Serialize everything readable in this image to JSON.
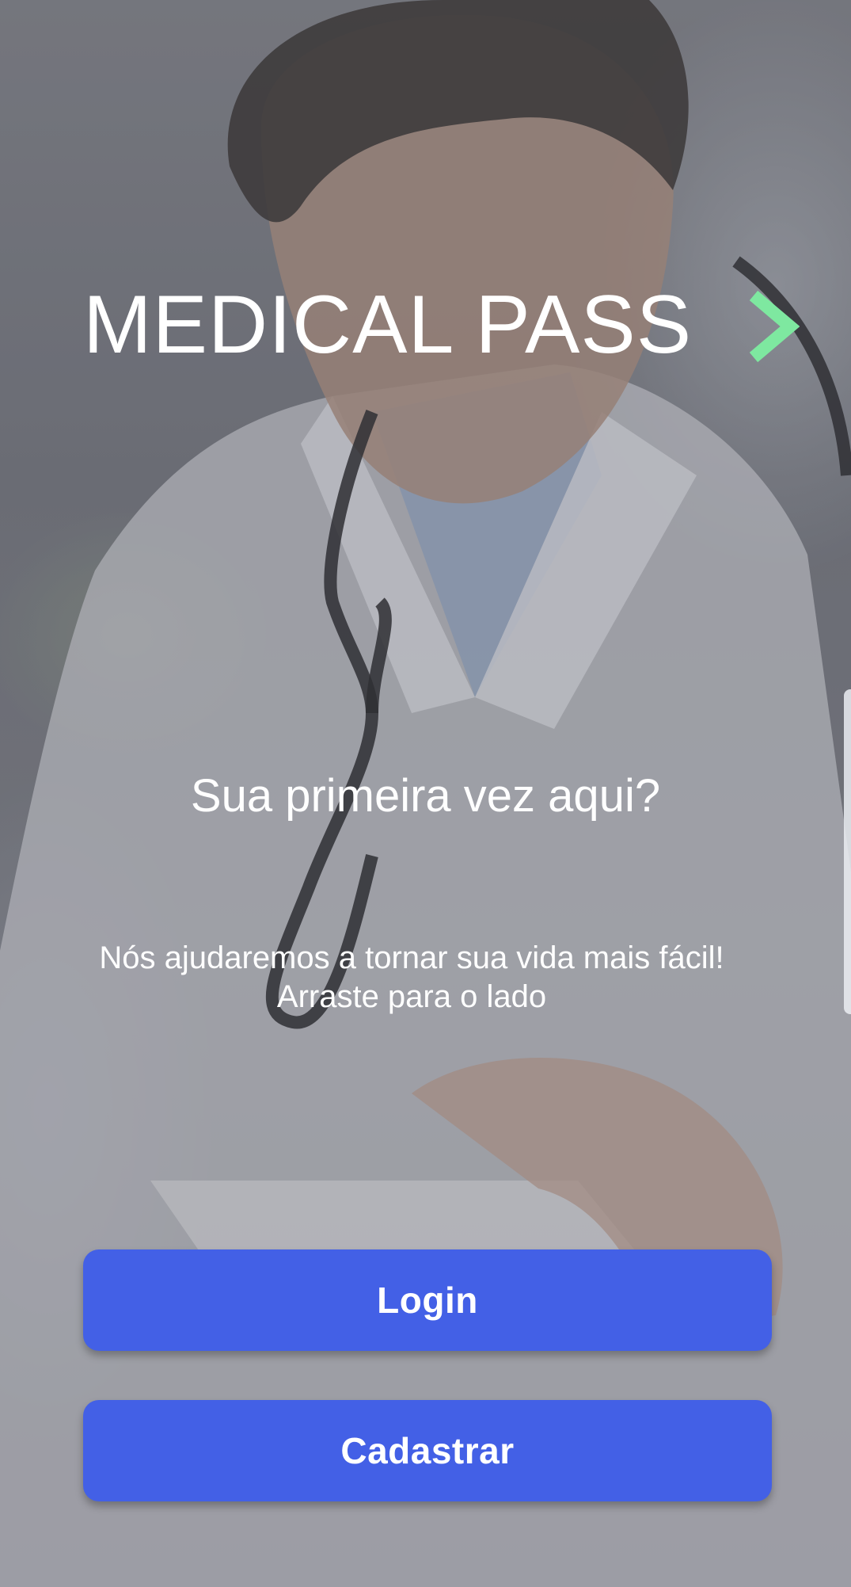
{
  "app": {
    "title": "MEDICAL PASS"
  },
  "header": {
    "next_icon": "chevron-right-icon"
  },
  "intro": {
    "question": "Sua primeira vez aqui?",
    "line1": "Nós ajudaremos a tornar sua vida mais fácil!",
    "line2": "Arraste para o lado"
  },
  "actions": {
    "login_label": "Login",
    "register_label": "Cadastrar"
  },
  "colors": {
    "button": "#4360e6",
    "arrow": "#7ee8a0",
    "text": "#ffffff"
  }
}
